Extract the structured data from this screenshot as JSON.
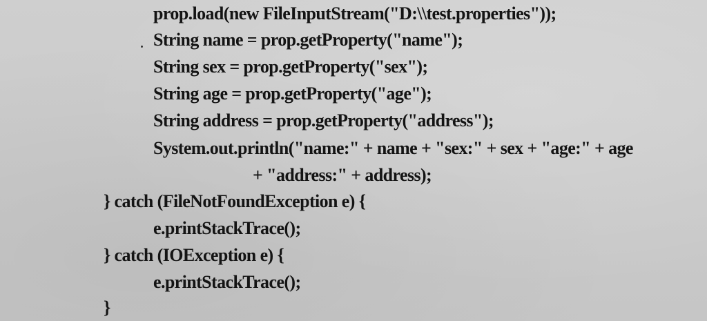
{
  "code_lines": [
    "prop.load(new FileInputStream(\"D:\\\\test.properties\"));",
    "String name = prop.getProperty(\"name\");",
    "String sex = prop.getProperty(\"sex\");",
    "String age = prop.getProperty(\"age\");",
    "String address = prop.getProperty(\"address\");",
    "System.out.println(\"name:\" + name + \"sex:\" + sex + \"age:\" + age",
    "+ \"address:\" + address);",
    "} catch (FileNotFoundException e) {",
    "e.printStackTrace();",
    "} catch (IOException e) {",
    "e.printStackTrace();",
    "}"
  ]
}
